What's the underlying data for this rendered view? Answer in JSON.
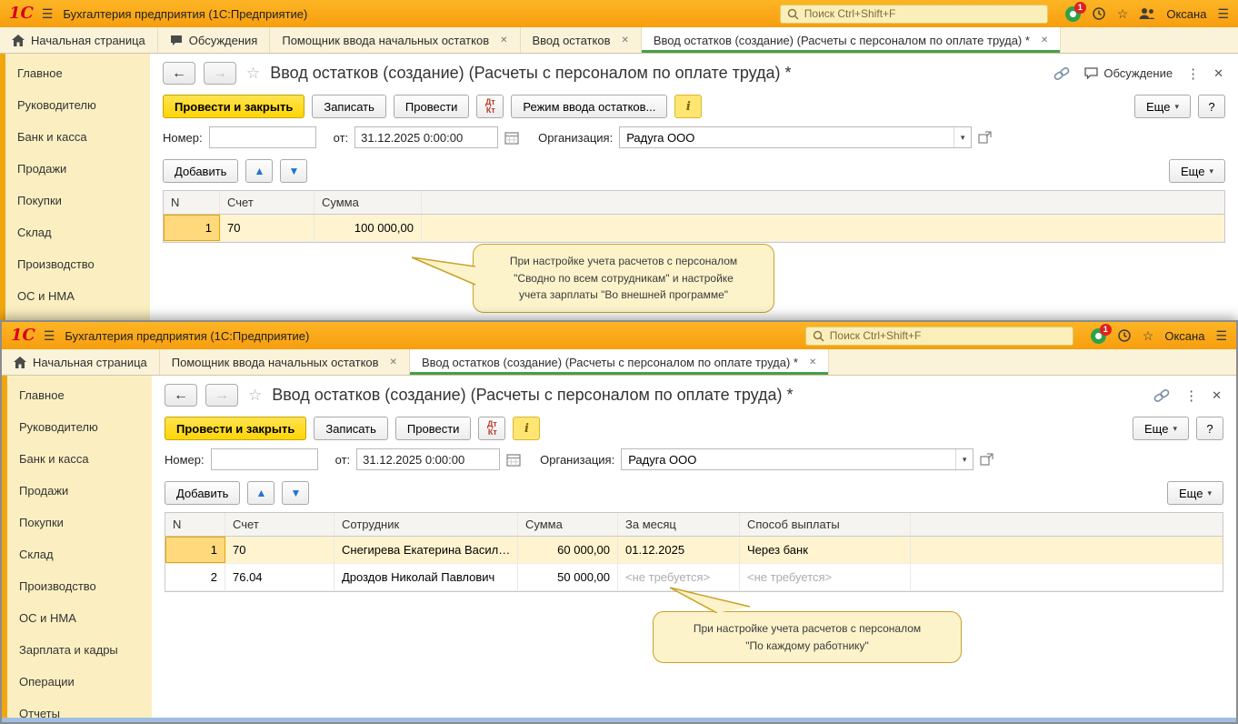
{
  "icons": {
    "menu": "☰",
    "close": "✕",
    "dots": "⋮",
    "star": "☆",
    "back": "←",
    "forward": "→",
    "dropdown": "▾",
    "up": "▲",
    "down": "▼"
  },
  "app": {
    "logo": "1С",
    "title": "Бухгалтерия предприятия  (1С:Предприятие)",
    "search_placeholder": "Поиск Ctrl+Shift+F",
    "notification_count": "1",
    "user": "Оксана"
  },
  "common": {
    "doc_title": "Ввод остатков (создание) (Расчеты с персоналом по оплате труда) *",
    "discussion_label": "Обсуждение",
    "buttons": {
      "post_close": "Провести и закрыть",
      "write": "Записать",
      "post": "Провести",
      "dt": "Дт",
      "kt": "Кт",
      "mode": "Режим ввода остатков...",
      "info": "i",
      "more": "Еще",
      "help": "?",
      "add": "Добавить"
    },
    "fields": {
      "number_label": "Номер:",
      "number_value": "",
      "from_label": "от:",
      "date_value": "31.12.2025 0:00:00",
      "org_label": "Организация:",
      "org_value": "Радуга ООО"
    }
  },
  "top_window": {
    "tabs": {
      "home": "Начальная страница",
      "discussions": "Обсуждения",
      "assistant": "Помощник ввода начальных остатков",
      "balances": "Ввод остатков",
      "active": "Ввод остатков (создание) (Расчеты с персоналом по оплате труда) *"
    },
    "sidebar": [
      "Главное",
      "Руководителю",
      "Банк и касса",
      "Продажи",
      "Покупки",
      "Склад",
      "Производство",
      "ОС и НМА"
    ],
    "table": {
      "columns": [
        "N",
        "Счет",
        "Сумма"
      ],
      "rows": [
        {
          "n": "1",
          "account": "70",
          "sum": "100 000,00"
        }
      ]
    },
    "callout": [
      "При настройке учета расчетов с персоналом",
      "\"Сводно по всем сотрудникам\" и настройке",
      "учета зарплаты \"Во внешней программе\""
    ]
  },
  "bottom_window": {
    "tabs": {
      "home": "Начальная страница",
      "assistant": "Помощник ввода начальных остатков",
      "active": "Ввод остатков (создание) (Расчеты с персоналом по оплате труда) *"
    },
    "sidebar": [
      "Главное",
      "Руководителю",
      "Банк и касса",
      "Продажи",
      "Покупки",
      "Склад",
      "Производство",
      "ОС и НМА",
      "Зарплата и кадры",
      "Операции",
      "Отчеты"
    ],
    "table": {
      "columns": [
        "N",
        "Счет",
        "Сотрудник",
        "Сумма",
        "За месяц",
        "Способ выплаты"
      ],
      "rows": [
        {
          "n": "1",
          "account": "70",
          "employee": "Снегирева Екатерина Васил…",
          "sum": "60 000,00",
          "month": "01.12.2025",
          "method": "Через банк"
        },
        {
          "n": "2",
          "account": "76.04",
          "employee": "Дроздов Николай Павлович",
          "sum": "50 000,00",
          "month": "<не требуется>",
          "method": "<не требуется>"
        }
      ]
    },
    "callout": [
      "При настройке учета расчетов с персоналом",
      "\"По каждому работнику\""
    ]
  }
}
